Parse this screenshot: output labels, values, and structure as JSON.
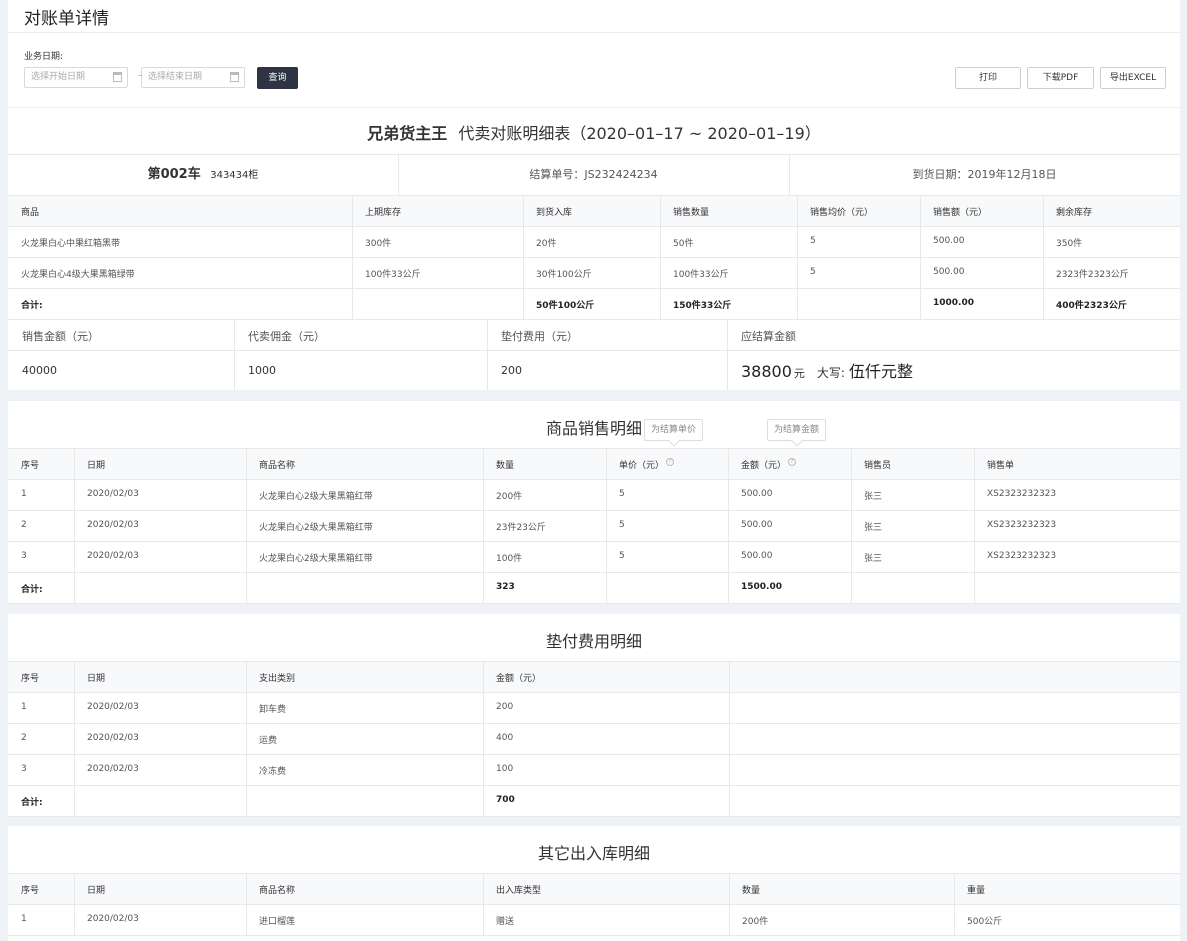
{
  "page": {
    "title": "对账单详情",
    "filter_label": "业务日期:",
    "start_placeholder": "选择开始日期",
    "end_placeholder": "选择结束日期",
    "range_sep": "–",
    "query_label": "查询",
    "print_label": "打印",
    "pdf_label": "下载PDF",
    "excel_label": "导出EXCEL"
  },
  "report": {
    "company": "兄弟货主王",
    "title": "代卖对账明细表（2020–01–17 ~  2020–01–19）",
    "truck": "第002车",
    "cabinet": "343434柜",
    "settle_no": "结算单号：JS232424234",
    "arrival": "到货日期：2019年12月18日",
    "headers": [
      "商品",
      "上期库存",
      "到货入库",
      "销售数量",
      "销售均价（元）",
      "销售额（元）",
      "剩余库存"
    ],
    "rows": [
      [
        "火龙果白心中果红箱黑带",
        "300件",
        "20件",
        "50件",
        "5",
        "500.00",
        "350件"
      ],
      [
        "火龙果白心4级大果黑箱绿带",
        "100件33公斤",
        "30件100公斤",
        "100件33公斤",
        "5",
        "500.00",
        "2323件2323公斤"
      ]
    ],
    "total": [
      "合计:",
      "",
      "50件100公斤",
      "150件33公斤",
      "",
      "1000.00",
      "400件2323公斤"
    ],
    "summary_headers": [
      "销售金额（元）",
      "代卖佣金（元）",
      "垫付费用（元）",
      "应结算金额"
    ],
    "summary_values": [
      "40000",
      "1000",
      "200"
    ],
    "settle_amount": "38800",
    "settle_unit": "元",
    "caps_label": "大写:",
    "caps_value": "伍仟元整"
  },
  "sales": {
    "title": "商品销售明细",
    "tooltip_price": "为结算单价",
    "tooltip_amount": "为结算金额",
    "question_mark": "?",
    "headers": [
      "序号",
      "日期",
      "商品名称",
      "数量",
      "单价（元）",
      "金额（元）",
      "销售员",
      "销售单"
    ],
    "rows": [
      [
        "1",
        "2020/02/03",
        "火龙果白心2级大果黑箱红带",
        "200件",
        "5",
        "500.00",
        "张三",
        "XS2323232323"
      ],
      [
        "2",
        "2020/02/03",
        "火龙果白心2级大果黑箱红带",
        "23件23公斤",
        "5",
        "500.00",
        "张三",
        "XS2323232323"
      ],
      [
        "3",
        "2020/02/03",
        "火龙果白心2级大果黑箱红带",
        "100件",
        "5",
        "500.00",
        "张三",
        "XS2323232323"
      ]
    ],
    "total": [
      "合计:",
      "",
      "",
      "323",
      "",
      "1500.00",
      "",
      ""
    ]
  },
  "advance": {
    "title": "垫付费用明细",
    "headers": [
      "序号",
      "日期",
      "支出类别",
      "金额（元）"
    ],
    "rows": [
      [
        "1",
        "2020/02/03",
        "卸车费",
        "200"
      ],
      [
        "2",
        "2020/02/03",
        "运费",
        "400"
      ],
      [
        "3",
        "2020/02/03",
        "冷冻费",
        "100"
      ]
    ],
    "total": [
      "合计:",
      "",
      "",
      "700"
    ]
  },
  "other": {
    "title": "其它出入库明细",
    "headers": [
      "序号",
      "日期",
      "商品名称",
      "出入库类型",
      "数量",
      "重量"
    ],
    "rows": [
      [
        "1",
        "2020/02/03",
        "进口榴莲",
        "赠送",
        "200件",
        "500公斤"
      ]
    ]
  }
}
